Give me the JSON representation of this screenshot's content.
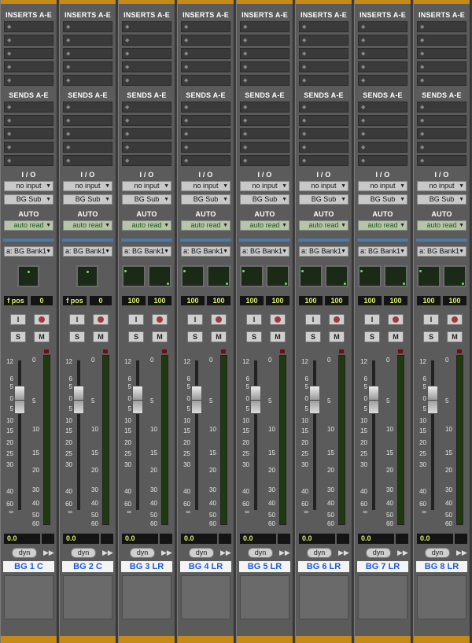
{
  "labels": {
    "inserts": "INSERTS A-E",
    "sends": "SENDS A-E",
    "io": "I / O",
    "auto": "AUTO",
    "solo": "S",
    "mute": "M",
    "input_mon": "I",
    "dyn": "dyn",
    "arrows": "▶▶"
  },
  "scale_left": [
    "12",
    "6",
    "5",
    "0",
    "5",
    "10",
    "15",
    "20",
    "25",
    "30",
    "40",
    "60",
    "∞"
  ],
  "scale_right": [
    "0",
    "5",
    "10",
    "15",
    "20",
    "30",
    "40",
    "50",
    "60"
  ],
  "strips": [
    {
      "name": "BG 1 C",
      "input": "no input",
      "output": "BG Sub",
      "automation": "auto read",
      "vca": "a: BG Bank1",
      "pan_type": "mono",
      "pan_label": "f pos",
      "pan_value": "0",
      "volume": "0.0"
    },
    {
      "name": "BG 2 C",
      "input": "no input",
      "output": "BG Sub",
      "automation": "auto read",
      "vca": "a: BG Bank1",
      "pan_type": "mono",
      "pan_label": "f pos",
      "pan_value": "0",
      "volume": "0.0"
    },
    {
      "name": "BG 3 LR",
      "input": "no input",
      "output": "BG Sub",
      "automation": "auto read",
      "vca": "a: BG Bank1",
      "pan_type": "stereo",
      "pan_left": "100",
      "pan_right": "100",
      "volume": "0.0"
    },
    {
      "name": "BG 4 LR",
      "input": "no input",
      "output": "BG Sub",
      "automation": "auto read",
      "vca": "a: BG Bank1",
      "pan_type": "stereo",
      "pan_left": "100",
      "pan_right": "100",
      "volume": "0.0"
    },
    {
      "name": "BG 5 LR",
      "input": "no input",
      "output": "BG Sub",
      "automation": "auto read",
      "vca": "a: BG Bank1",
      "pan_type": "stereo",
      "pan_left": "100",
      "pan_right": "100",
      "volume": "0.0"
    },
    {
      "name": "BG 6 LR",
      "input": "no input",
      "output": "BG Sub",
      "automation": "auto read",
      "vca": "a: BG Bank1",
      "pan_type": "stereo",
      "pan_left": "100",
      "pan_right": "100",
      "volume": "0.0"
    },
    {
      "name": "BG 7 LR",
      "input": "no input",
      "output": "BG Sub",
      "automation": "auto read",
      "vca": "a: BG Bank1",
      "pan_type": "stereo",
      "pan_left": "100",
      "pan_right": "100",
      "volume": "0.0"
    },
    {
      "name": "BG 8 LR",
      "input": "no input",
      "output": "BG Sub",
      "automation": "auto read",
      "vca": "a: BG Bank1",
      "pan_type": "stereo",
      "pan_left": "100",
      "pan_right": "100",
      "volume": "0.0"
    }
  ]
}
